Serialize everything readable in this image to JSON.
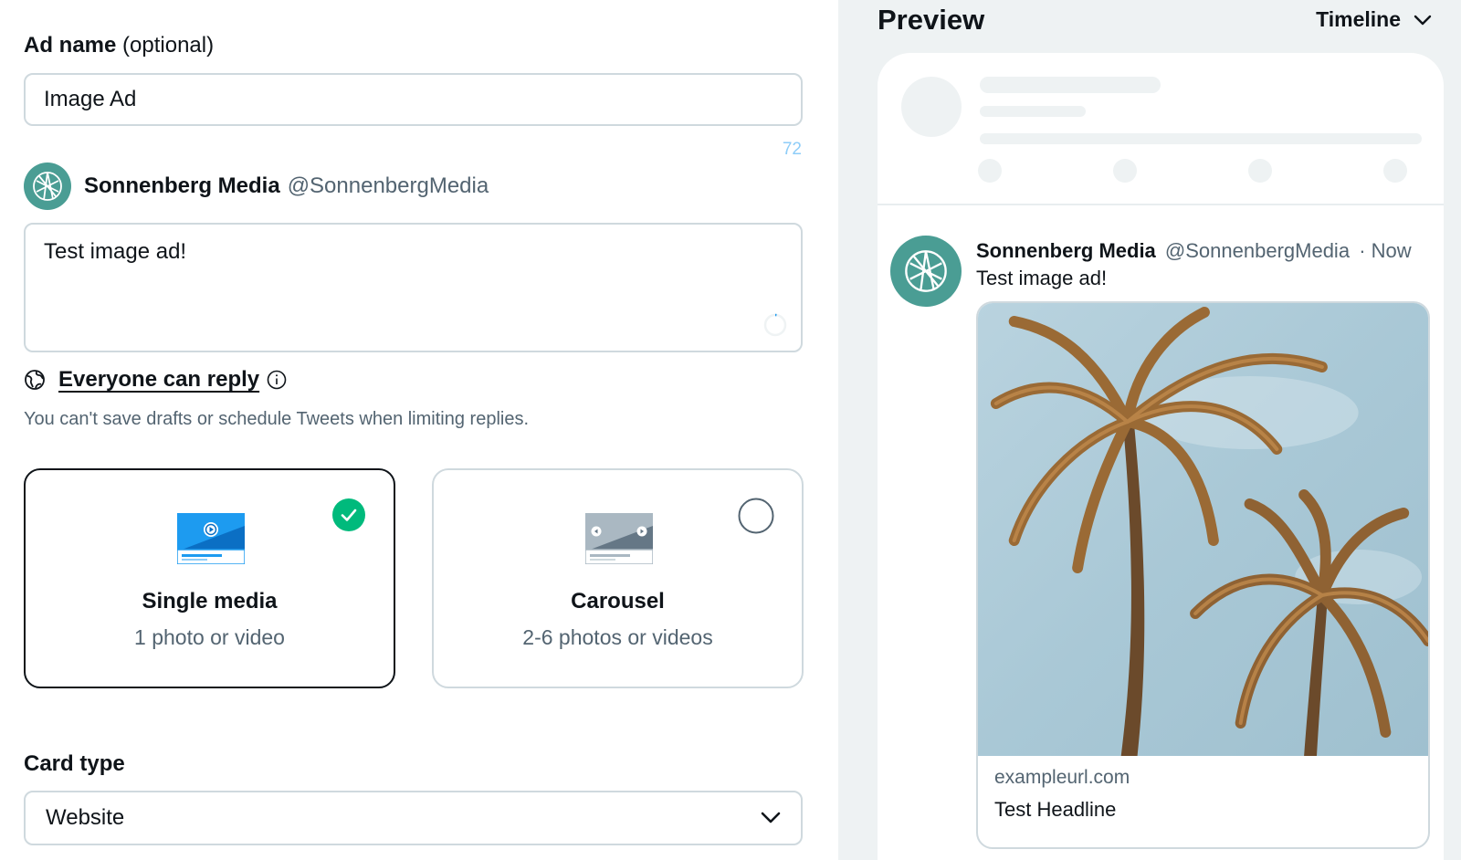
{
  "form": {
    "ad_name_label": "Ad name",
    "ad_name_optional": "(optional)",
    "ad_name_value": "Image Ad",
    "char_counter": "72",
    "account": {
      "name": "Sonnenberg Media",
      "handle": "@SonnenbergMedia"
    },
    "tweet_text": "Test image ad!",
    "reply_setting": "Everyone can reply",
    "reply_note": "You can't save drafts or schedule Tweets when limiting replies.",
    "media_options": [
      {
        "title": "Single media",
        "subtitle": "1 photo or video",
        "selected": true
      },
      {
        "title": "Carousel",
        "subtitle": "2-6 photos or videos",
        "selected": false
      }
    ],
    "card_type_label": "Card type",
    "card_type_value": "Website"
  },
  "preview": {
    "title": "Preview",
    "placement": "Timeline",
    "post": {
      "name": "Sonnenberg Media",
      "handle": "@SonnenbergMedia",
      "time": "· Now",
      "text": "Test image ad!",
      "card_url": "exampleurl.com",
      "card_headline": "Test Headline"
    }
  },
  "colors": {
    "accent": "#1d9bf0",
    "success": "#00ba7c",
    "avatar": "#4a9d94",
    "muted": "#536471",
    "border": "#cfd9de"
  },
  "icons": [
    "globe-icon",
    "info-icon",
    "check-icon",
    "chevron-down-icon",
    "avatar-logo-icon",
    "single-media-icon",
    "carousel-icon"
  ]
}
